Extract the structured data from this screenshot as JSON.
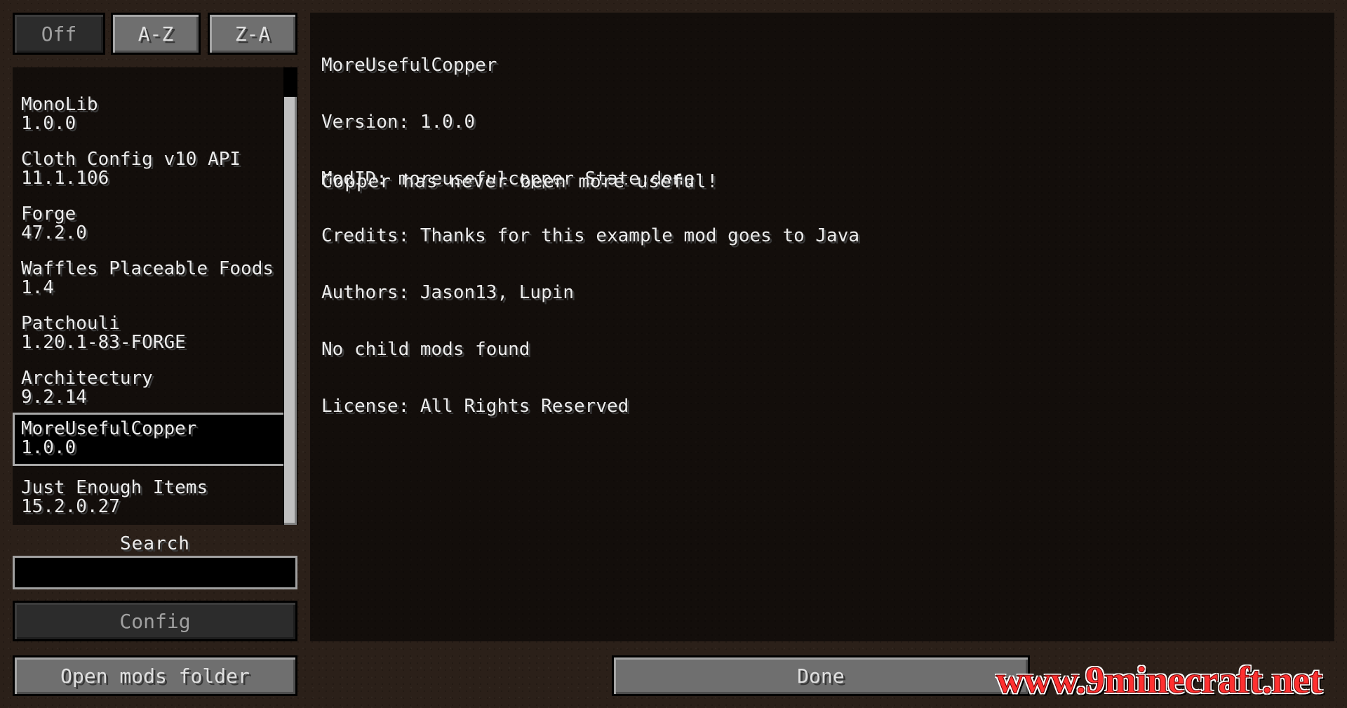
{
  "sort_buttons": {
    "off": "Off",
    "az": "A-Z",
    "za": "Z-A"
  },
  "mod_list": [
    {
      "name": "MonoLib",
      "version": "1.0.0"
    },
    {
      "name": "Cloth Config v10 API",
      "version": "11.1.106"
    },
    {
      "name": "Forge",
      "version": "47.2.0"
    },
    {
      "name": "Waffles Placeable Foods",
      "version": "1.4"
    },
    {
      "name": "Patchouli",
      "version": "1.20.1-83-FORGE"
    },
    {
      "name": "Architectury",
      "version": "9.2.14"
    },
    {
      "name": "MoreUsefulCopper",
      "version": "1.0.0",
      "selected": true
    },
    {
      "name": "Just Enough Items",
      "version": "15.2.0.27"
    }
  ],
  "search": {
    "label": "Search",
    "value": ""
  },
  "buttons": {
    "config": "Config",
    "open_mods_folder": "Open mods folder",
    "done": "Done"
  },
  "info": {
    "name": "MoreUsefulCopper",
    "version": "Version: 1.0.0",
    "modid": "ModID: moreusefulcopper State:done",
    "credits": "Credits: Thanks for this example mod goes to Java",
    "authors": "Authors: Jason13, Lupin",
    "children": "No child mods found",
    "license": "License: All Rights Reserved",
    "description": "Copper has never been more useful!"
  },
  "watermark": "www.9minecraft.net"
}
